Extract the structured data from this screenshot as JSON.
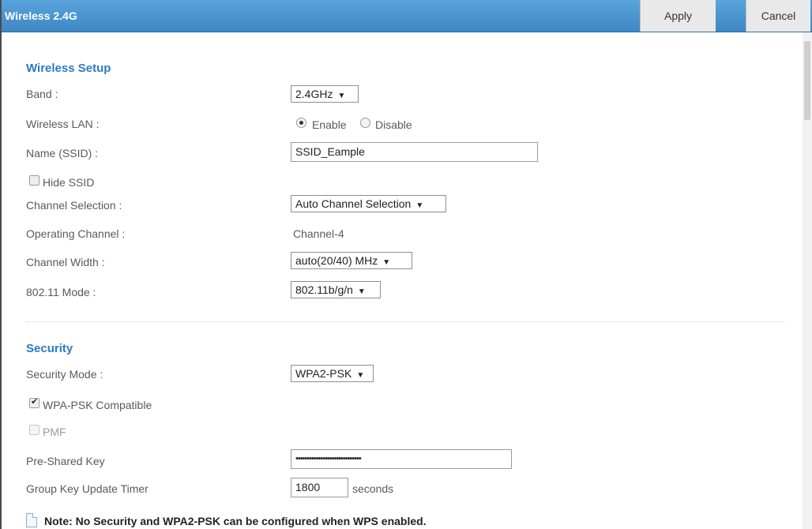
{
  "header": {
    "title": "Wireless 2.4G",
    "apply_label": "Apply",
    "cancel_label": "Cancel"
  },
  "wireless_setup": {
    "section_title": "Wireless Setup",
    "band": {
      "label": "Band :",
      "value": "2.4GHz"
    },
    "wireless_lan": {
      "label": "Wireless LAN :",
      "options": [
        "Enable",
        "Disable"
      ],
      "selected": "Enable"
    },
    "ssid": {
      "label": "Name (SSID) :",
      "value": "SSID_Eample"
    },
    "hide_ssid": {
      "label": "Hide SSID",
      "checked": false
    },
    "channel_selection": {
      "label": "Channel Selection :",
      "value": "Auto Channel Selection"
    },
    "operating_channel": {
      "label": "Operating Channel :",
      "value": "Channel-4"
    },
    "channel_width": {
      "label": "Channel Width :",
      "value": "auto(20/40) MHz"
    },
    "mode": {
      "label": "802.11 Mode :",
      "value": "802.11b/g/n"
    }
  },
  "security": {
    "section_title": "Security",
    "security_mode": {
      "label": "Security Mode :",
      "value": "WPA2-PSK"
    },
    "wpa_psk_compatible": {
      "label": "WPA-PSK Compatible",
      "checked": true
    },
    "pmf": {
      "label": "PMF",
      "checked": false,
      "disabled": true
    },
    "pre_shared_key": {
      "label": "Pre-Shared Key",
      "value": "•••••••••••••••••••••••••••••"
    },
    "group_key_timer": {
      "label": "Group Key Update Timer",
      "value": "1800",
      "unit": "seconds"
    }
  },
  "note": "Note: No Security and WPA2-PSK can be configured when WPS enabled.",
  "colors": {
    "header_blue": "#3e87c4",
    "section_blue": "#2c7ac6"
  }
}
